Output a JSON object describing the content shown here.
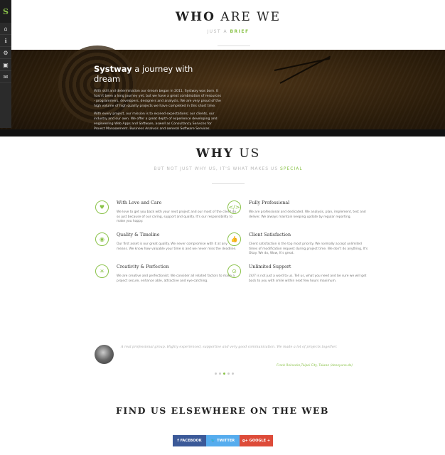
{
  "nav": {
    "logo": "S",
    "items": [
      {
        "icon": "home-icon",
        "glyph": "⌂"
      },
      {
        "icon": "info-icon",
        "glyph": "ℹ"
      },
      {
        "icon": "cogs-icon",
        "glyph": "⚙"
      },
      {
        "icon": "briefcase-icon",
        "glyph": "▣"
      },
      {
        "icon": "envelope-icon",
        "glyph": "✉"
      }
    ]
  },
  "who": {
    "title_strong": "WHO",
    "title_rest": " ARE WE",
    "sub_pre": "JUST A ",
    "sub_accent": "BRIEF"
  },
  "about": {
    "brand": "Systway",
    "tagline": " a journey with dream",
    "p1": "With skill and determination our dream began in 2011. Systway was born. It hasn't been a long journey yet, but we have a great combination of resources - programmers, developers, designers and analysts. We are very proud of the high volume of high quality projects we have completed in this short time.",
    "p2": "With every project, our mission is to exceed expectations; our clients, our industry and our own. We offer a great depth of experience developing and engineering Web Apps and Software, aswell as Consultancy Services for Project Management, Business Analysis and general Software Services."
  },
  "why": {
    "title_strong": "WHY",
    "title_rest": " US",
    "sub_pre": "BUT NOT JUST WHY US, IT'S WHAT MAKES US ",
    "sub_accent": "SPECIAL",
    "features": [
      {
        "icon": "heart-icon",
        "glyph": "♥",
        "title": "With Love and Care",
        "text": "We love to get you back with your next project and our most of the client do so just because of our caring, support and quality. It's our responsibility to make you happy."
      },
      {
        "icon": "code-icon",
        "glyph": "</>",
        "title": "Fully Professional",
        "text": "We are professional and dedicated. We analysis, plan, implement, test and deliver. We always maintain keeping update by regular reporting."
      },
      {
        "icon": "eye-icon",
        "glyph": "◉",
        "title": "Quality & Timeline",
        "text": "Our first asset is our great quality. We never compromise with it at any means. We know how valuable your time is and we never miss the deadline."
      },
      {
        "icon": "thumbs-up-icon",
        "glyph": "👍",
        "title": "Client Satisfaction",
        "text": "Client satisfaction is the top most priority. We normally accept unlimited times of modification request during project time. We don't do anything, It's Okay. We do, Wow, It's great."
      },
      {
        "icon": "lightbulb-icon",
        "glyph": "☀",
        "title": "Creativity & Perfection",
        "text": "We are creative and perfectionist. We consider all related factors to make a project secure, enhance able, attractive and eye-catching."
      },
      {
        "icon": "support-icon",
        "glyph": "⊙",
        "title": "Unlimited Support",
        "text": "24/7 is not just a word to us. Tell us, what you need and be sure we will get back to you with smile within next few hours maximum."
      }
    ]
  },
  "testimonial": {
    "quote": "A real professional group. Highly experienced, supportive and very good communication. We made a lot of projects together.",
    "author": "Frank Reinecke,Taipei City, Taiwan (doneyuno.de)",
    "slides": 5,
    "active": 2
  },
  "elsewhere": {
    "title": "FIND US ELSEWHERE ON THE WEB",
    "links": [
      {
        "label": "FACEBOOK",
        "glyph": "f",
        "cls": "fb",
        "icon": "facebook-icon"
      },
      {
        "label": "TWITTER",
        "glyph": "🐦",
        "cls": "tw",
        "icon": "twitter-icon"
      },
      {
        "label": "GOOGLE +",
        "glyph": "g+",
        "cls": "gp",
        "icon": "google-plus-icon"
      }
    ]
  }
}
